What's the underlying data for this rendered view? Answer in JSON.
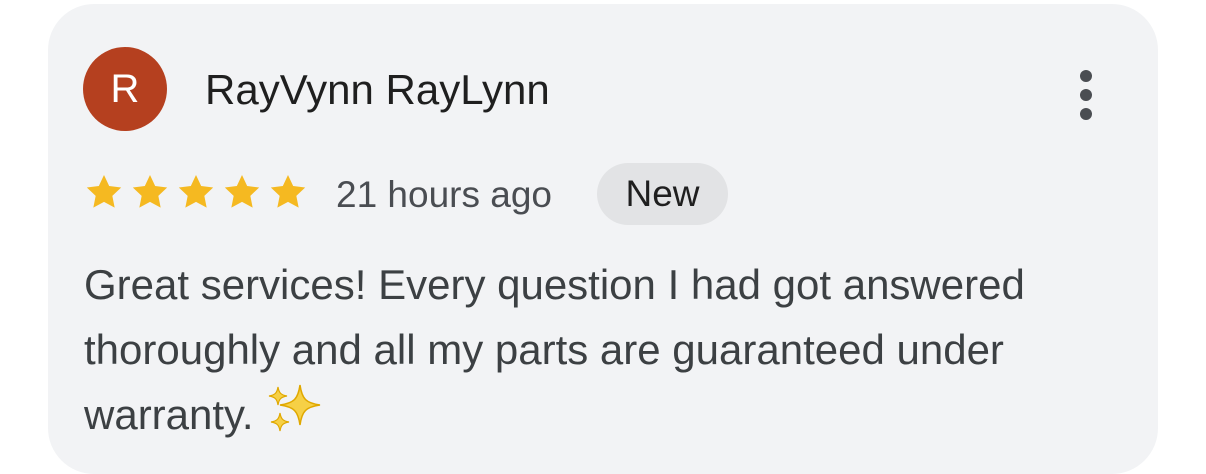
{
  "review": {
    "avatar_initial": "R",
    "avatar_color": "#b5401f",
    "author_name": "RayVynn RayLynn",
    "rating": 5,
    "rating_max": 5,
    "star_color": "#f5b921",
    "timestamp": "21 hours ago",
    "badge_label": "New",
    "text": "Great services! Every question I had got answered thoroughly and all my parts are guaranteed under warranty.",
    "emoji": "sparkles",
    "menu_icon": "more-vertical-icon"
  }
}
